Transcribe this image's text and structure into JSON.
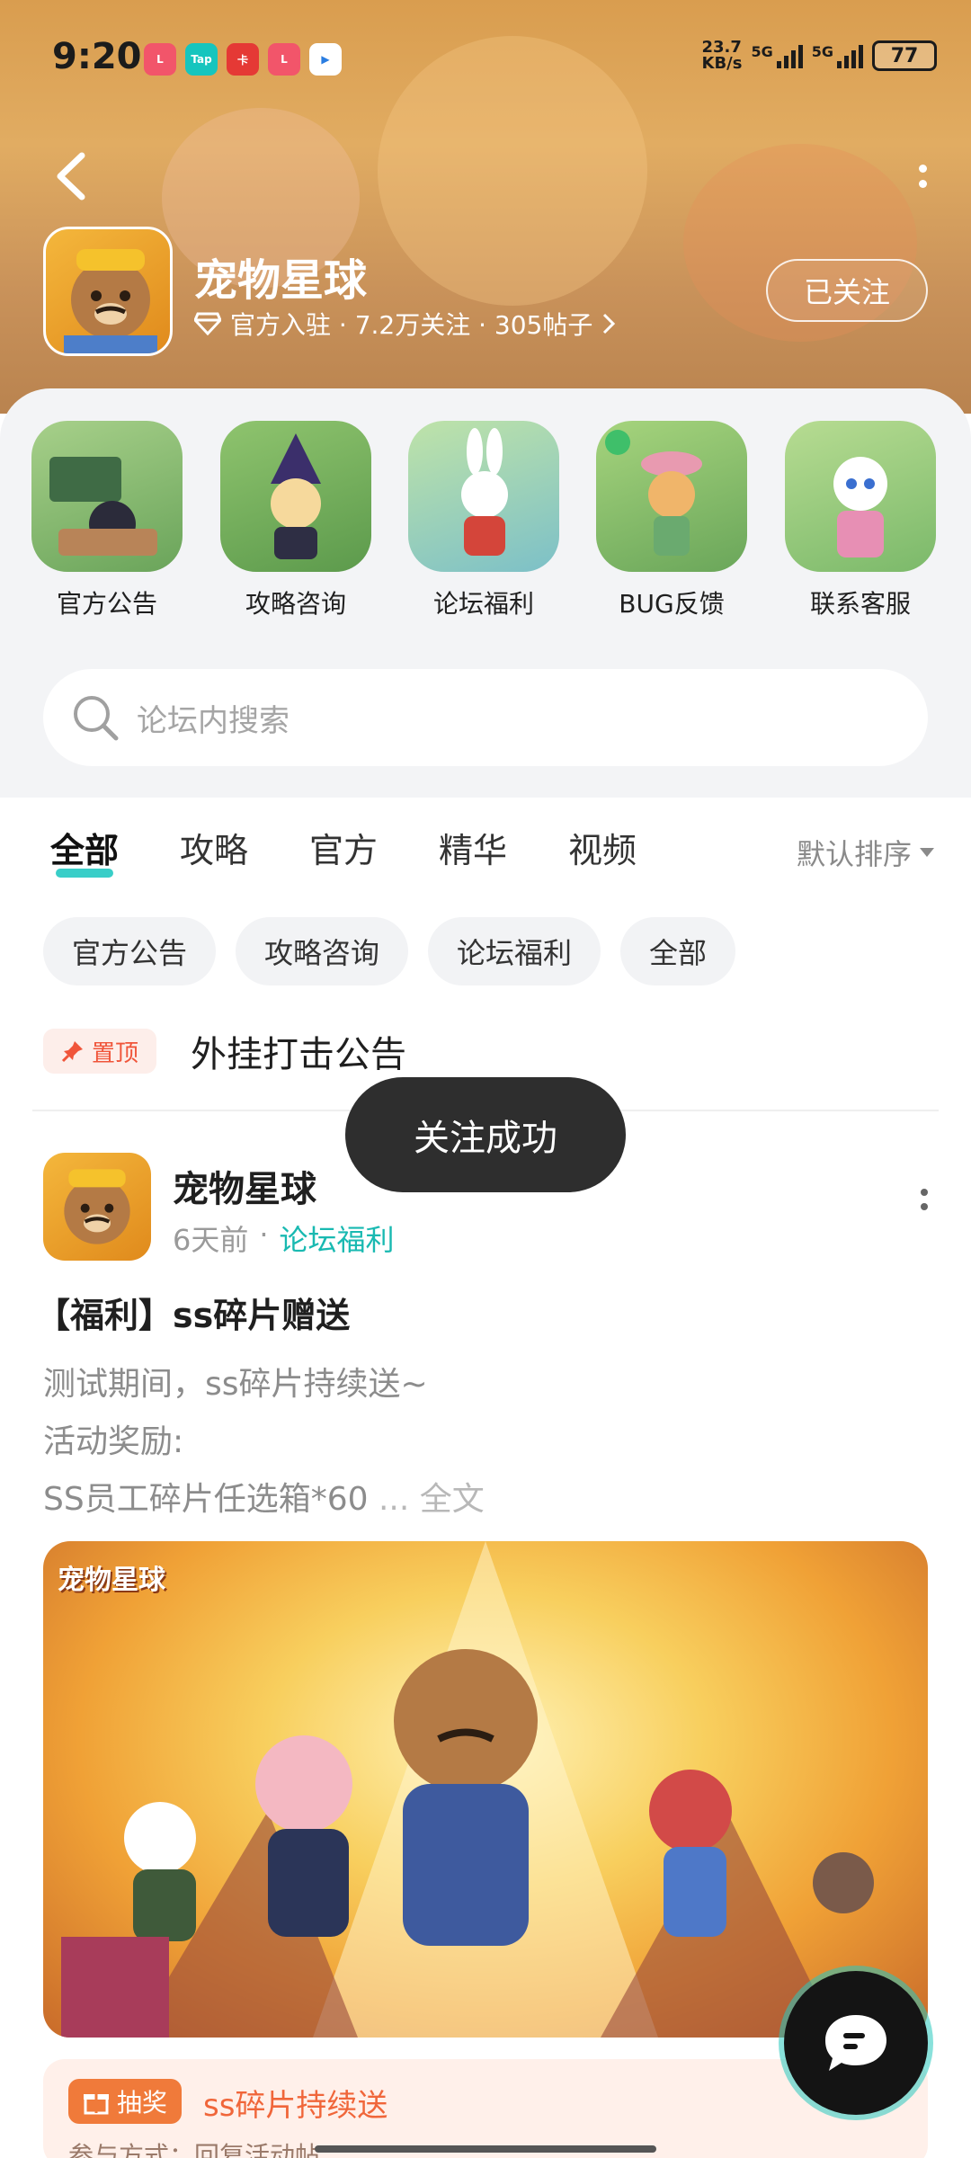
{
  "status_bar": {
    "time": "9:20",
    "net_speed": "23.7",
    "net_unit": "KB/s",
    "signal_1": "5G",
    "signal_2": "5G",
    "battery": "77",
    "app_icons": [
      {
        "label": "lofter",
        "color": "#f2556a"
      },
      {
        "label": "Tap",
        "color": "#16c5be"
      },
      {
        "label": "卡",
        "color": "#e53935"
      },
      {
        "label": "lofter",
        "color": "#f2556a"
      },
      {
        "label": "▶",
        "color": "#2a7de1"
      }
    ]
  },
  "header": {
    "forum_name": "宠物星球",
    "meta": "官方入驻 · 7.2万关注 · 305帖子",
    "follow_label": "已关注"
  },
  "shortcuts": [
    {
      "label": "官方公告",
      "color": "#7fb96b"
    },
    {
      "label": "攻略咨询",
      "color": "#6ea86b"
    },
    {
      "label": "论坛福利",
      "color": "#8fc89a"
    },
    {
      "label": "BUG反馈",
      "color": "#7fbf69"
    },
    {
      "label": "联系客服",
      "color": "#86c46a"
    }
  ],
  "search": {
    "placeholder": "论坛内搜索"
  },
  "tabs": [
    {
      "label": "全部",
      "active": true
    },
    {
      "label": "攻略",
      "active": false
    },
    {
      "label": "官方",
      "active": false
    },
    {
      "label": "精华",
      "active": false
    },
    {
      "label": "视频",
      "active": false
    }
  ],
  "sort_label": "默认排序",
  "chips": [
    "官方公告",
    "攻略咨询",
    "论坛福利",
    "全部"
  ],
  "pinned": {
    "badge": "置顶",
    "title": "外挂打击公告"
  },
  "post": {
    "author": "宠物星球",
    "time": "6天前",
    "category": "论坛福利",
    "title": "【福利】ss碎片赠送",
    "body_lines": [
      "测试期间，ss碎片持续送~",
      "活动奖励:",
      "SS员工碎片任选箱*60"
    ],
    "read_more": "... 全文",
    "image_caption": "宠物星球"
  },
  "lottery": {
    "tag": "抽奖",
    "title": "ss碎片持续送",
    "sub": "参与方式：回复活动帖"
  },
  "toast": "关注成功",
  "accent": "#16c5be"
}
